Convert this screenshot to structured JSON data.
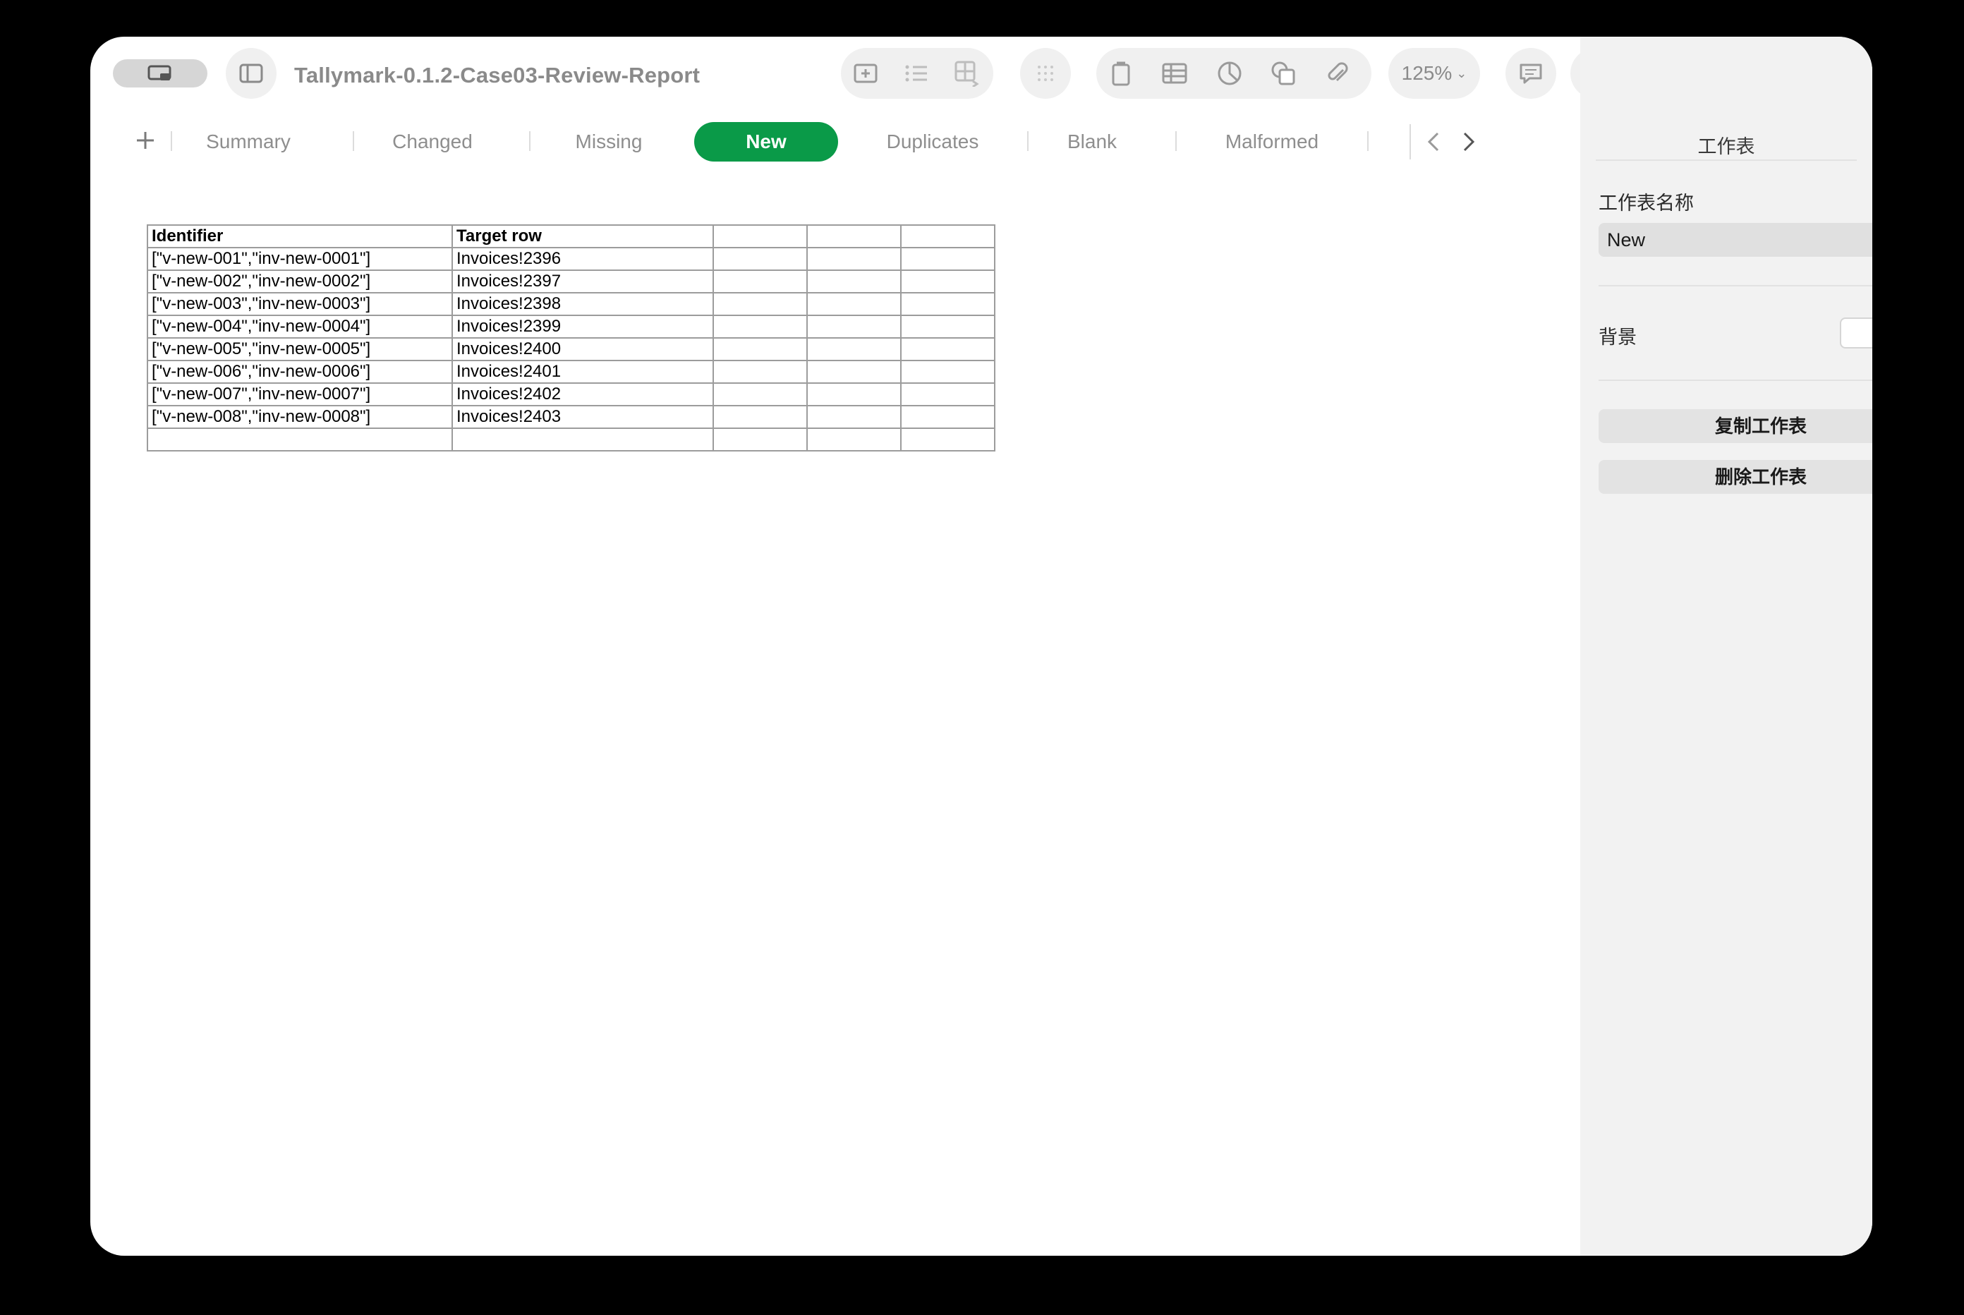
{
  "toolbar": {
    "document_title": "Tallymark-0.1.2-Case03-Review-Report",
    "zoom_label": "125%"
  },
  "tabs": {
    "items": [
      {
        "label": "Summary"
      },
      {
        "label": "Changed"
      },
      {
        "label": "Missing"
      },
      {
        "label": "New"
      },
      {
        "label": "Duplicates"
      },
      {
        "label": "Blank"
      },
      {
        "label": "Malformed"
      }
    ],
    "active_index": 3,
    "active_color": "#0a9a48"
  },
  "table": {
    "headers": [
      "Identifier",
      "Target row",
      "",
      "",
      ""
    ],
    "rows": [
      [
        "[\"v-new-001\",\"inv-new-0001\"]",
        "Invoices!2396"
      ],
      [
        "[\"v-new-002\",\"inv-new-0002\"]",
        "Invoices!2397"
      ],
      [
        "[\"v-new-003\",\"inv-new-0003\"]",
        "Invoices!2398"
      ],
      [
        "[\"v-new-004\",\"inv-new-0004\"]",
        "Invoices!2399"
      ],
      [
        "[\"v-new-005\",\"inv-new-0005\"]",
        "Invoices!2400"
      ],
      [
        "[\"v-new-006\",\"inv-new-0006\"]",
        "Invoices!2401"
      ],
      [
        "[\"v-new-007\",\"inv-new-0007\"]",
        "Invoices!2402"
      ],
      [
        "[\"v-new-008\",\"inv-new-0008\"]",
        "Invoices!2403"
      ],
      [
        "",
        ""
      ]
    ]
  },
  "sidebar": {
    "title": "工作表",
    "sheet_name_label": "工作表名称",
    "sheet_name_value": "New",
    "background_label": "背景",
    "background_color": "#ffffff",
    "duplicate_button": "复制工作表",
    "delete_button": "删除工作表"
  }
}
